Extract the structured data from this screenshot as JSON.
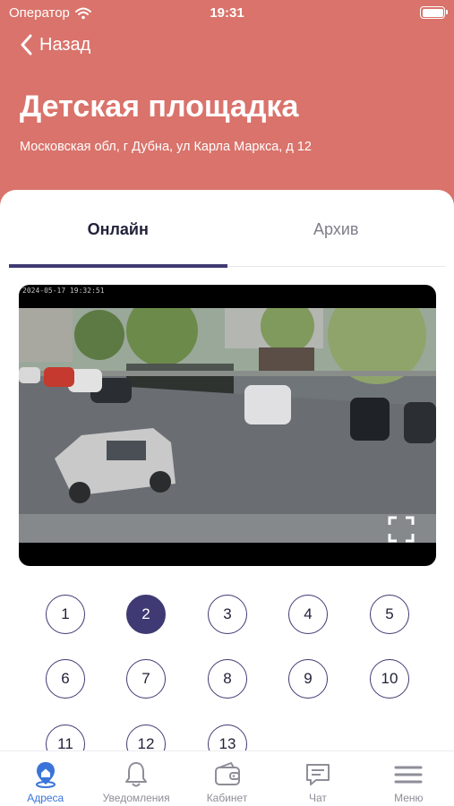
{
  "status_bar": {
    "carrier": "Оператор",
    "time": "19:31"
  },
  "header": {
    "back_label": "Назад",
    "title": "Детская площадка",
    "address": "Московская обл, г Дубна, ул Карла Маркса, д 12"
  },
  "tabs": [
    {
      "label": "Онлайн",
      "active": true
    },
    {
      "label": "Архив",
      "active": false
    }
  ],
  "video": {
    "timestamp": "2024-05-17 19:32:51"
  },
  "cameras": {
    "selected": "2",
    "numbers": [
      "1",
      "2",
      "3",
      "4",
      "5",
      "6",
      "7",
      "8",
      "9",
      "10",
      "11",
      "12",
      "13"
    ]
  },
  "tabbar": [
    {
      "label": "Адреса",
      "icon": "location-pin-icon",
      "active": true
    },
    {
      "label": "Уведомления",
      "icon": "bell-icon",
      "active": false
    },
    {
      "label": "Кабинет",
      "icon": "wallet-icon",
      "active": false
    },
    {
      "label": "Чат",
      "icon": "chat-icon",
      "active": false
    },
    {
      "label": "Меню",
      "icon": "menu-icon",
      "active": false
    }
  ],
  "colors": {
    "header_bg": "#d9736b",
    "accent": "#3f3a73",
    "active_tab": "#3a74d9"
  }
}
